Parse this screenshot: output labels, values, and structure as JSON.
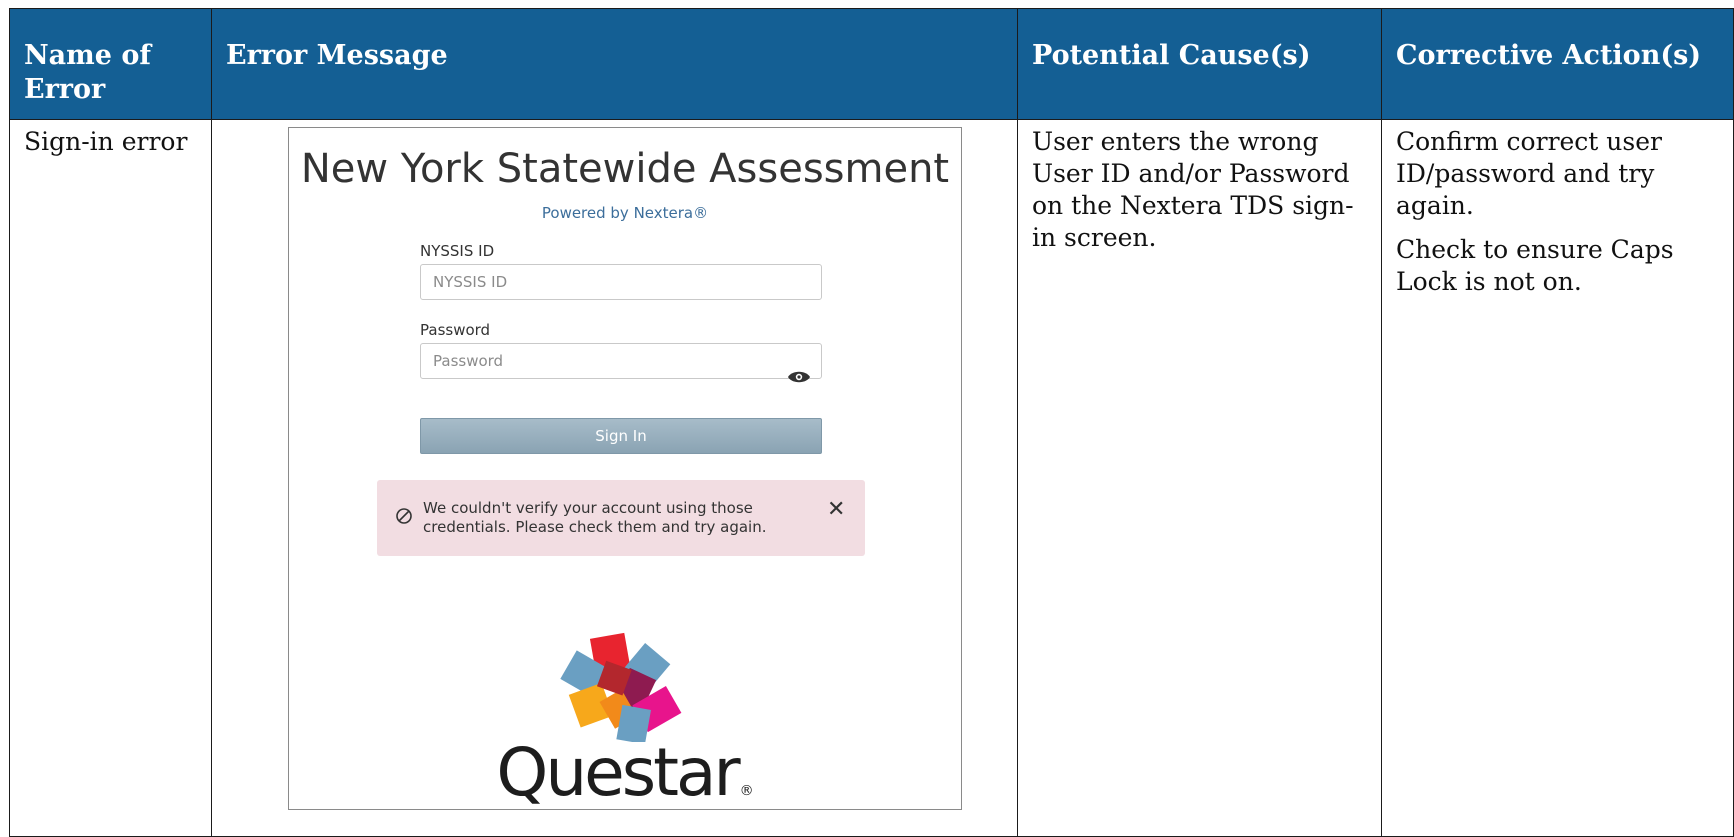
{
  "table": {
    "headers": [
      "Name of Error",
      "Error Message",
      "Potential Cause(s)",
      "Corrective Action(s)"
    ],
    "row": {
      "name": "Sign-in error",
      "cause": "User enters the wrong\nUser ID and/or Password\non the Nextera TDS sign-\nin screen.",
      "actions": [
        "Confirm correct user\nID/password and try\nagain.",
        "Check to ensure Caps\nLock is not on."
      ]
    }
  },
  "screenshot": {
    "title": "New York Statewide Assessment",
    "subtitle": "Powered by Nextera®",
    "id_label": "NYSSIS ID",
    "id_placeholder": "NYSSIS ID",
    "password_label": "Password",
    "password_placeholder": "Password",
    "signin_label": "Sign In",
    "alert_text": "We couldn't verify your account using those credentials. Please check them and try again.",
    "alert_close": "✕",
    "logo_text": "Questar",
    "logo_reg": "®",
    "icons": {
      "eye": "eye-icon",
      "alert": "blocked-circle-icon",
      "close": "close-icon",
      "logo": "questar-pinwheel-logo"
    }
  },
  "colors": {
    "header_bg": "#145f94",
    "header_text": "#ffffff",
    "alert_bg": "#f2dde2",
    "button": "#94abbb"
  }
}
